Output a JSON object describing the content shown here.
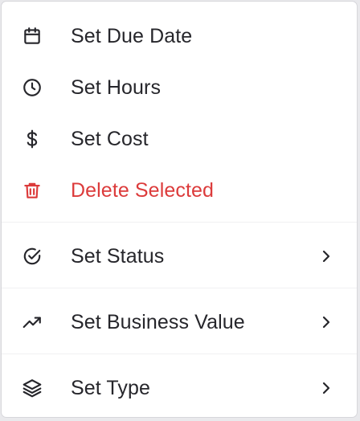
{
  "menu": {
    "items": [
      {
        "label": "Set Due Date",
        "icon": "calendar-icon",
        "submenu": false
      },
      {
        "label": "Set Hours",
        "icon": "clock-icon",
        "submenu": false
      },
      {
        "label": "Set Cost",
        "icon": "dollar-icon",
        "submenu": false
      },
      {
        "label": "Delete Selected",
        "icon": "trash-icon",
        "submenu": false,
        "color": "#dc3b3b"
      },
      {
        "label": "Set Status",
        "icon": "check-circle-icon",
        "submenu": true
      },
      {
        "label": "Set Business Value",
        "icon": "trending-up-icon",
        "submenu": true
      },
      {
        "label": "Set Type",
        "icon": "layers-icon",
        "submenu": true
      }
    ]
  },
  "colors": {
    "text": "#26262b",
    "danger": "#dc3b3b",
    "background": "#ffffff",
    "border": "#d7d7db"
  }
}
